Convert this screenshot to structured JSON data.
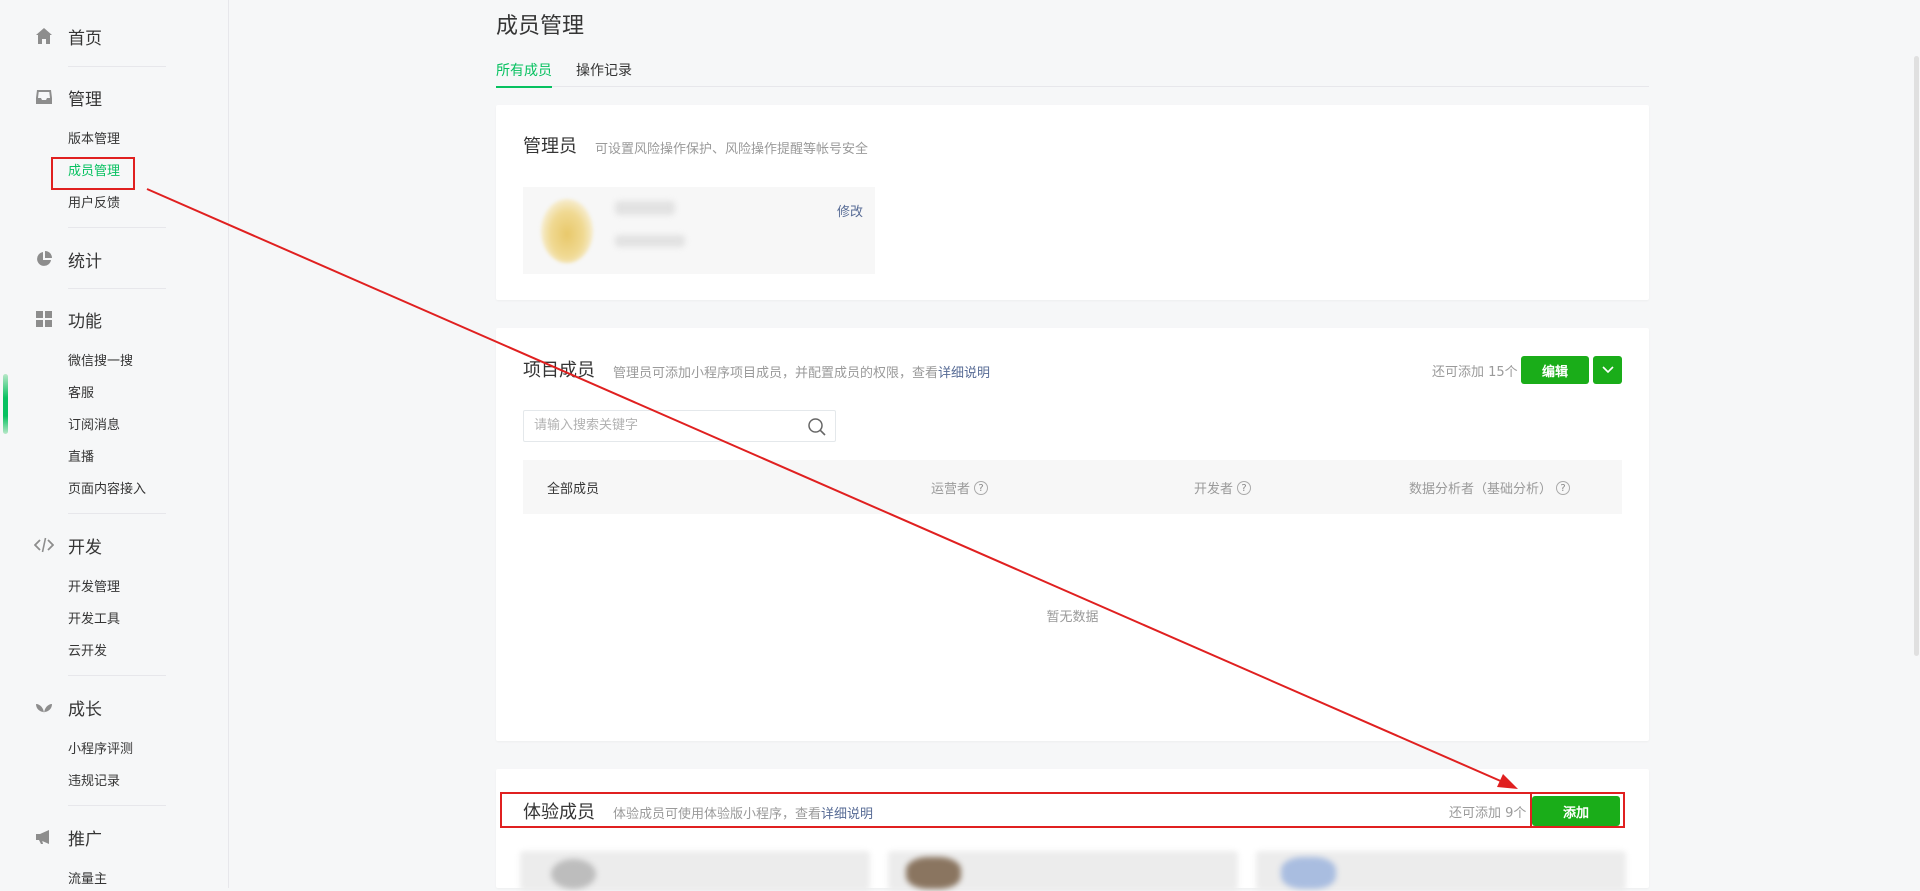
{
  "sidebar": {
    "groups": [
      {
        "label": "首页",
        "icon": "home-icon",
        "items": []
      },
      {
        "label": "管理",
        "icon": "inbox-icon",
        "items": [
          "版本管理",
          "成员管理",
          "用户反馈"
        ]
      },
      {
        "label": "统计",
        "icon": "pie-chart-icon",
        "items": []
      },
      {
        "label": "功能",
        "icon": "grid-icon",
        "items": [
          "微信搜一搜",
          "客服",
          "订阅消息",
          "直播",
          "页面内容接入"
        ]
      },
      {
        "label": "开发",
        "icon": "code-icon",
        "items": [
          "开发管理",
          "开发工具",
          "云开发"
        ]
      },
      {
        "label": "成长",
        "icon": "sprout-icon",
        "items": [
          "小程序评测",
          "违规记录"
        ]
      },
      {
        "label": "推广",
        "icon": "megaphone-icon",
        "items": [
          "流量主"
        ]
      }
    ],
    "active_item": "成员管理"
  },
  "page": {
    "title": "成员管理",
    "tabs": [
      "所有成员",
      "操作记录"
    ]
  },
  "admin_card": {
    "title": "管理员",
    "desc": "可设置风险操作保护、风险操作提醒等帐号安全",
    "edit_link": "修改"
  },
  "project_card": {
    "title": "项目成员",
    "desc": "管理员可添加小程序项目成员，并配置成员的权限，查看",
    "desc_link": "详细说明",
    "quota": "还可添加 15个",
    "edit_button": "编辑",
    "search_placeholder": "请输入搜索关键字",
    "columns": [
      "全部成员",
      "运营者",
      "开发者",
      "数据分析者（基础分析）"
    ],
    "empty_text": "暂无数据"
  },
  "trial_card": {
    "title": "体验成员",
    "desc": "体验成员可使用体验版小程序，查看",
    "desc_link": "详细说明",
    "quota": "还可添加 9个",
    "add_button": "添加"
  },
  "colors": {
    "accent": "#07c160",
    "button": "#1aad19",
    "annotation": "#e02020",
    "link": "#576b95"
  }
}
